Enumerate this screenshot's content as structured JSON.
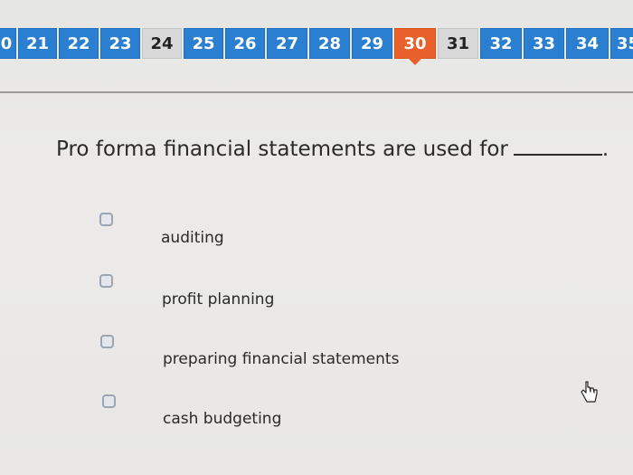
{
  "question_nav": [
    {
      "label": "0",
      "state": "default"
    },
    {
      "label": "21",
      "state": "default"
    },
    {
      "label": "22",
      "state": "default"
    },
    {
      "label": "23",
      "state": "default"
    },
    {
      "label": "24",
      "state": "visited"
    },
    {
      "label": "25",
      "state": "default"
    },
    {
      "label": "26",
      "state": "default"
    },
    {
      "label": "27",
      "state": "default"
    },
    {
      "label": "28",
      "state": "default"
    },
    {
      "label": "29",
      "state": "default"
    },
    {
      "label": "30",
      "state": "current"
    },
    {
      "label": "31",
      "state": "visited"
    },
    {
      "label": "32",
      "state": "default"
    },
    {
      "label": "33",
      "state": "default"
    },
    {
      "label": "34",
      "state": "default"
    },
    {
      "label": "35",
      "state": "default"
    }
  ],
  "colors": {
    "nav_default": "#2a7fd0",
    "nav_visited": "#d8d8d8",
    "nav_current": "#e8602a"
  },
  "question": {
    "text": "Pro forma financial statements are used for",
    "trailing": "."
  },
  "options": [
    {
      "label": "auditing",
      "checked": false
    },
    {
      "label": "profit planning",
      "checked": false
    },
    {
      "label": "preparing financial statements",
      "checked": false
    },
    {
      "label": "cash budgeting",
      "checked": false
    }
  ]
}
